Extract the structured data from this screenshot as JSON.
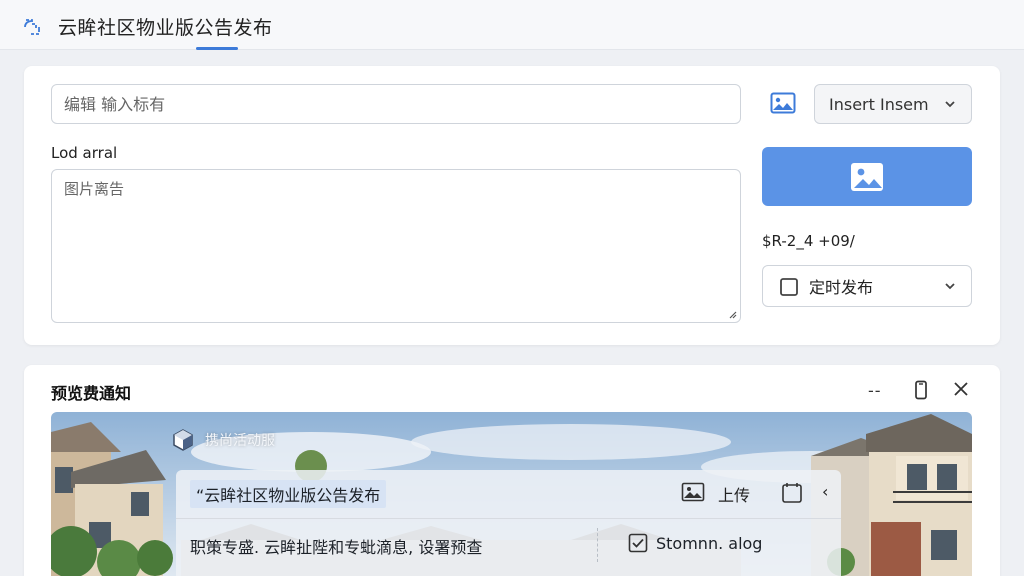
{
  "header": {
    "app_title": "云眸社区物业版公告发布",
    "logo_icon": "cloud-community-logo-icon"
  },
  "editor": {
    "title_placeholder": "编辑 输入标有",
    "insert_select_label": "Insert Insem",
    "body_label": "Lod arral",
    "body_placeholder": "图片离告",
    "upload_icon": "image-icon",
    "publish_time_label": "$R-2_4 +09/",
    "schedule_select_label": "定时发布"
  },
  "preview": {
    "title": "预览费通知",
    "minimize_label": "--",
    "overlay": {
      "brand_label": "携尚活动服",
      "notice_title": "“云眸社区物业版公告发布",
      "upload_label": "上传",
      "caret": "‹",
      "body_text": "职策专盛. 云眸扯陛和专蚍滴息, 设署预查",
      "checkbox_label": "Stomnn. alog"
    }
  },
  "colors": {
    "accent": "#3d7bd9",
    "upload_button": "#5b93e6",
    "page_bg": "#eef0f4"
  }
}
